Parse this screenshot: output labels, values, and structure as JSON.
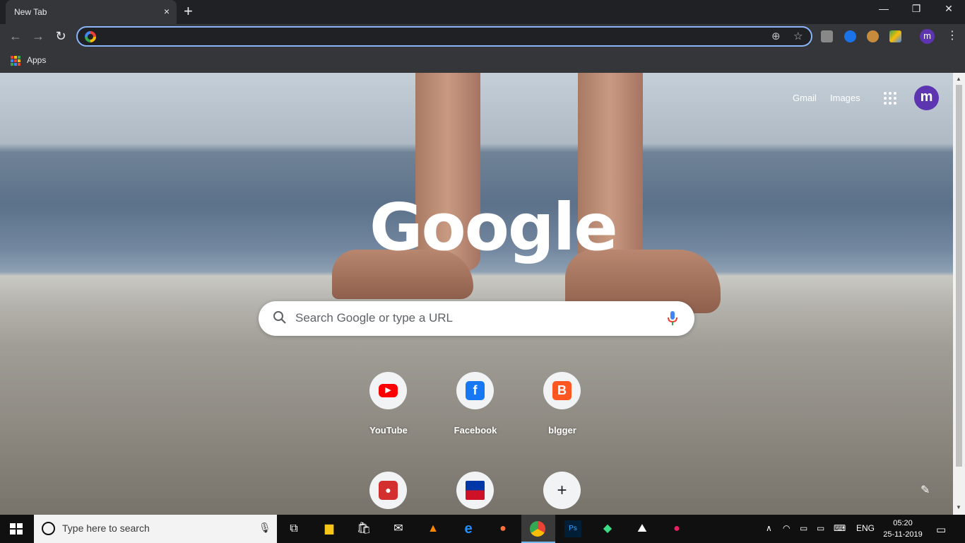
{
  "browser": {
    "tab_title": "New Tab",
    "tab_close": "×",
    "new_tab": "+",
    "window_minimize": "—",
    "window_restore": "❐",
    "window_close": "✕",
    "nav_back": "←",
    "nav_forward": "→",
    "nav_reload": "↻",
    "omnibox_value": "",
    "zoom_icon": "⊕",
    "star_icon": "☆",
    "profile_initial": "m",
    "menu_icon": "⋮",
    "bookmarks": {
      "apps_label": "Apps"
    }
  },
  "ntp": {
    "gmail_link": "Gmail",
    "images_link": "Images",
    "avatar_initial": "m",
    "logo_text": "Google",
    "search_placeholder": "Search Google or type a URL",
    "shortcuts": [
      {
        "label": "YouTube",
        "icon": "youtube-icon",
        "color": "#ff0000"
      },
      {
        "label": "Facebook",
        "icon": "facebook-icon",
        "color": "#1877f2"
      },
      {
        "label": "blgger",
        "icon": "blogger-icon",
        "color": "#ff5722"
      },
      {
        "label": "",
        "icon": "office-icon",
        "color": "#d32f2f"
      },
      {
        "label": "",
        "icon": "flag-icon",
        "color": "#0038a8"
      },
      {
        "label": "",
        "icon": "add-shortcut-icon",
        "glyph": "+"
      }
    ],
    "customize_icon": "✎"
  },
  "taskbar": {
    "search_placeholder": "Type here to search",
    "language": "ENG",
    "time": "05:20",
    "date": "25-11-2019"
  },
  "colors": {
    "chrome_frame": "#202124",
    "chrome_toolbar": "#35363a",
    "omnibox_focus": "#8ab4f8",
    "avatar": "#5e35b1",
    "taskbar": "#101010"
  }
}
